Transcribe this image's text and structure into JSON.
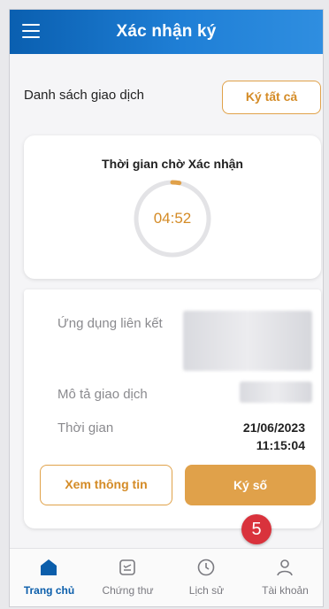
{
  "header": {
    "title": "Xác nhận ký"
  },
  "list": {
    "title": "Danh sách giao dịch",
    "sign_all_label": "Ký tất cả"
  },
  "timer": {
    "title": "Thời gian chờ Xác nhận",
    "countdown": "04:52",
    "remaining_fraction": 0.97
  },
  "transaction": {
    "app_label": "Ứng dụng liên kết",
    "desc_label": "Mô tả giao dịch",
    "time_label": "Thời gian",
    "date": "21/06/2023",
    "time": "11:15:04"
  },
  "actions": {
    "view_label": "Xem thông tin",
    "sign_label": "Ký số"
  },
  "step_badge": "5",
  "nav": [
    {
      "label": "Trang chủ",
      "icon": "home-icon"
    },
    {
      "label": "Chứng thư",
      "icon": "certificate-icon"
    },
    {
      "label": "Lịch sử",
      "icon": "clock-icon"
    },
    {
      "label": "Tài khoản",
      "icon": "user-icon"
    }
  ],
  "colors": {
    "primary": "#0b5eab",
    "accent": "#e0a14a",
    "badge": "#d9323c"
  }
}
